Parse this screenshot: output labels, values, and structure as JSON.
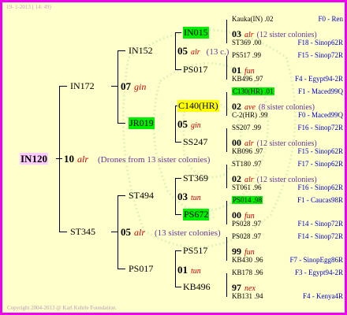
{
  "date": "19- 1-2013 ( 14: 49)",
  "copyright": "Copyright 2004-2013 @ Karl Kehrle Foundation.",
  "root": {
    "name": "IN120",
    "num": "10",
    "sym": "alr",
    "note": "(Drones from 13 sister colonies)"
  },
  "g1": {
    "top": {
      "name": "IN172",
      "num": "07",
      "sym": "gin"
    },
    "bottom": {
      "name": "ST345",
      "num": "05",
      "sym": "alr",
      "note": "(13 sister colonies)"
    }
  },
  "g2": {
    "in152": {
      "name": "IN152",
      "num": "05",
      "sym": "alr",
      "note": "(13 c.)"
    },
    "jr019": {
      "name": "JR019",
      "num": "05",
      "sym": "gin"
    },
    "st494": {
      "name": "ST494",
      "num": "03",
      "sym": "tun"
    },
    "ps017b": {
      "name": "PS017",
      "num": "01",
      "sym": "tun"
    }
  },
  "g3": {
    "in015": "IN015",
    "ps017a": "PS017",
    "c140": "C140(HR)",
    "ss247": "SS247",
    "st369": "ST369",
    "ps672": "PS672",
    "ps517": "PS517",
    "kb496": "KB496",
    "n02_num": "02",
    "n02_sym": "ave",
    "n02_note": "(8 sister colonies)",
    "n00a_num": "00",
    "n00a_sym": "alr",
    "n00a_note": "(12 sister colonies)",
    "n00b_num": "00",
    "n00b_sym": "fun",
    "n99_num": "99",
    "n99_sym": "fun",
    "n03_num": "03",
    "n03_sym": "alr",
    "n03_note": "(12 sister colonies)",
    "n01_num": "01",
    "n01_sym": "fun",
    "n02b_num": "02",
    "n02b_sym": "alr",
    "n02b_note": "(12 sister colonies)",
    "n97_num": "97",
    "n97_sym": "nex"
  },
  "g4": [
    {
      "name": "Kauka(IN) .02",
      "src": "F0 - Ren"
    },
    {
      "name": "ST369 .00",
      "src": "F18 - Sinop62R"
    },
    {
      "name": "PS517 .99",
      "src": "F15 - Sinop72R"
    },
    {
      "name": "KB496 .97",
      "src": "F4 - Egypt94-2R"
    },
    {
      "name": "C130(HR) .01",
      "src": "F1 - Maced99Q"
    },
    {
      "name": "C-2(HR) .99",
      "src": "F0 - Maced99Q"
    },
    {
      "name": "SS207 .99",
      "src": "F16 - Sinop72R"
    },
    {
      "name": "KB096 .97",
      "src": "F15 - Sinop62R"
    },
    {
      "name": "ST180 .97",
      "src": "F17 - Sinop62R"
    },
    {
      "name": "ST061 .96",
      "src": "F16 - Sinop62R"
    },
    {
      "name": "PS014 .98",
      "src": "F1 - Caucas98R"
    },
    {
      "name": "PS028 .97",
      "src": "F14 - Sinop72R"
    },
    {
      "name": "PS028 .97",
      "src": "F14 - Sinop72R"
    },
    {
      "name": "KB430 .96",
      "src": "F7 - SinopEgg86R"
    },
    {
      "name": "KB178 .96",
      "src": "F3 - Egypt94-2R"
    },
    {
      "name": "KB131 .94",
      "src": "F4 - Kenya4R"
    }
  ]
}
